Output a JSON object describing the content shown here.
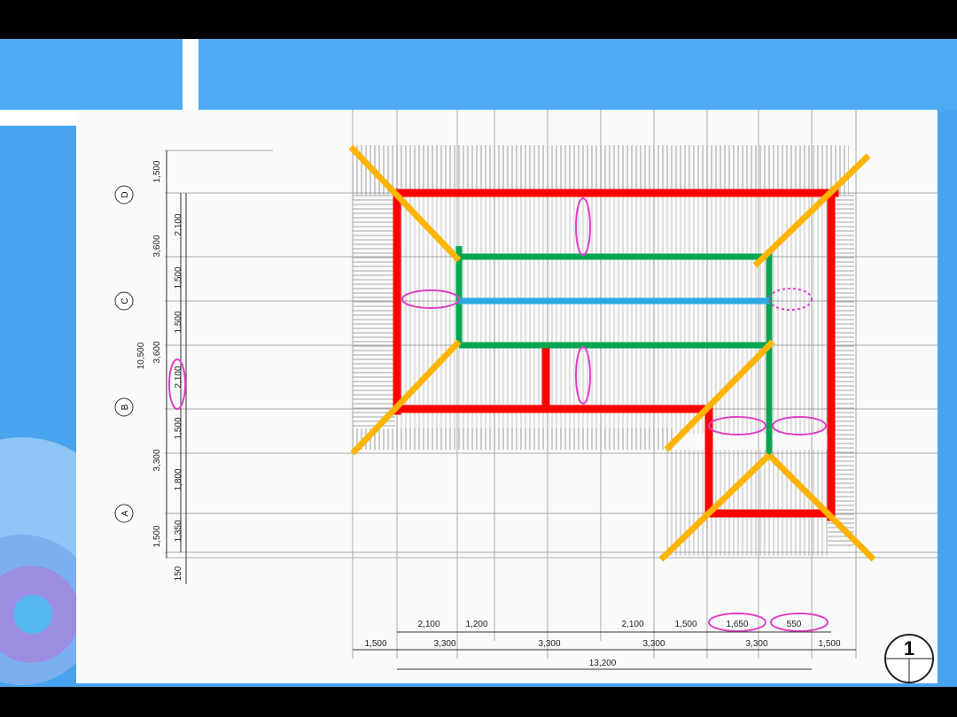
{
  "grid_axes": [
    "D",
    "C",
    "B",
    "A"
  ],
  "vertical_dims_outer": {
    "top": "1,500",
    "total": "10,500",
    "bottom": "1,500"
  },
  "vertical_dims_mid": [
    "3,600",
    "3,600",
    "3,300"
  ],
  "vertical_dims_inner": [
    "2,100",
    "1,500",
    "1,500",
    "2,100",
    "1,500",
    "1,800",
    "1,350",
    "150"
  ],
  "horizontal_dims_top": [
    "2,100",
    "1,200",
    "2,100",
    "1,500",
    "1,650",
    "550"
  ],
  "horizontal_dims_mid": [
    "1,500",
    "3,300",
    "3,300",
    "3,300",
    "3,300",
    "1,500"
  ],
  "horizontal_dims_total": "13,200",
  "drawing_number": "1",
  "overlay_colors": {
    "outer_frame": "#ff0000",
    "inner_frame": "#00a651",
    "ridge": "#29abe2",
    "hip_lines": "#ffb400",
    "highlight_ellipses": "#e040c8"
  }
}
